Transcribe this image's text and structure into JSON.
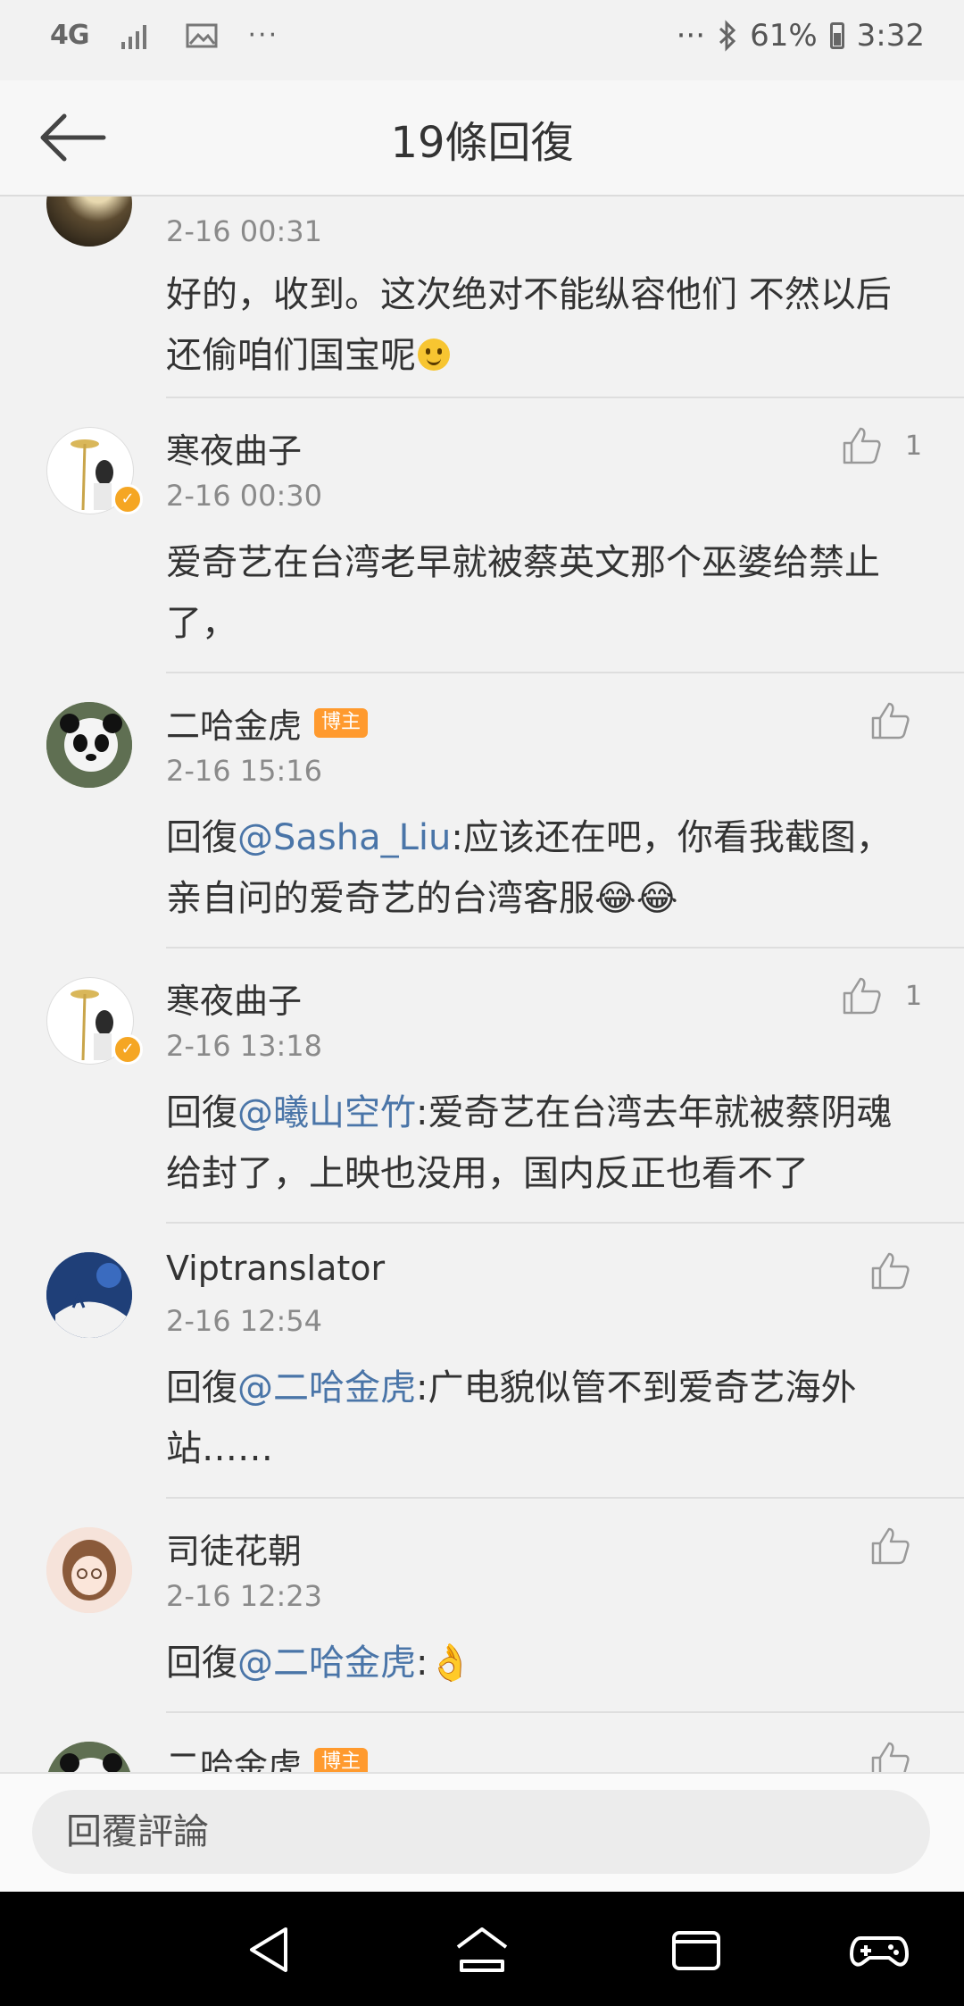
{
  "status_bar": {
    "network": "4G",
    "more": "···",
    "more_right": "···",
    "battery": "61%",
    "time": "3:32"
  },
  "header": {
    "title": "19條回復"
  },
  "comments": [
    {
      "name": "",
      "time": "2-16 00:31",
      "text": "好的，收到。这次绝对不能纵容他们 不然以后还偷咱们国宝呢",
      "likes": ""
    },
    {
      "name": "寒夜曲子",
      "time": "2-16 00:30",
      "text": "爱奇艺在台湾老早就被蔡英文那个巫婆给禁止了，",
      "likes": "1"
    },
    {
      "name": "二哈金虎",
      "badge": "博主",
      "time": "2-16 15:16",
      "reply_prefix": "回復",
      "mention": "@Sasha_Liu",
      "text": ":应该还在吧，你看我截图，亲自问的爱奇艺的台湾客服😂😂",
      "likes": ""
    },
    {
      "name": "寒夜曲子",
      "time": "2-16 13:18",
      "reply_prefix": "回復",
      "mention": "@曦山空竹",
      "text": ":爱奇艺在台湾去年就被蔡阴魂给封了，上映也没用，国内反正也看不了",
      "likes": "1"
    },
    {
      "name": "Viptranslator",
      "time": "2-16 12:54",
      "reply_prefix": "回復",
      "mention": "@二哈金虎",
      "text": ":广电貌似管不到爱奇艺海外站……",
      "likes": ""
    },
    {
      "name": "司徒花朝",
      "time": "2-16 12:23",
      "reply_prefix": "回復",
      "mention": "@二哈金虎",
      "text": ":👌",
      "likes": ""
    },
    {
      "name": "二哈金虎",
      "badge": "博主"
    }
  ],
  "reply_bar": {
    "placeholder": "回覆評論"
  },
  "colors": {
    "mention": "#4a75a8",
    "badge": "#ff9a2e",
    "verified": "#f5a623"
  }
}
